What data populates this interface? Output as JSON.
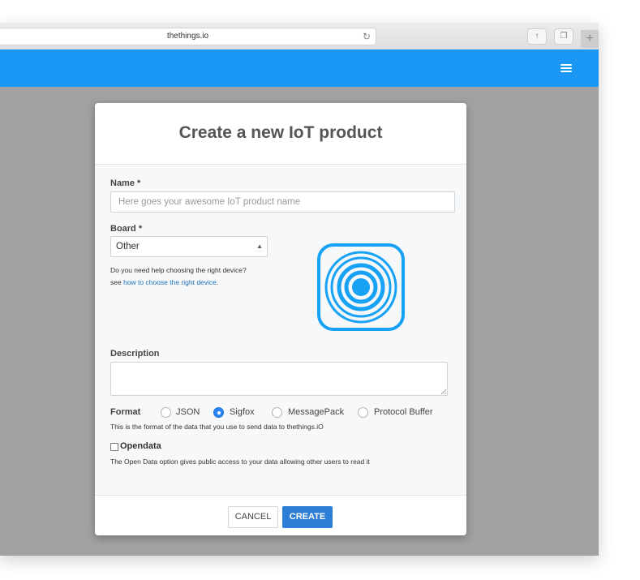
{
  "browser": {
    "url": "thethings.io",
    "reload_icon": "reload-icon",
    "share_icon": "share-icon",
    "tabs_icon": "tabs-icon",
    "new_tab_icon": "plus-icon"
  },
  "app_header": {
    "menu_icon": "hamburger-icon",
    "color": "#1a97f5"
  },
  "modal": {
    "title": "Create a new IoT product",
    "name": {
      "label": "Name *",
      "placeholder": "Here goes your awesome IoT product name",
      "value": ""
    },
    "board": {
      "label": "Board *",
      "selected": "Other",
      "help_line1": "Do you need help choosing the right device?",
      "help_prefix": "see ",
      "help_link": "how to choose the right device",
      "help_suffix": ".",
      "icon": "signal-icon",
      "icon_color": "#17a2f5"
    },
    "description": {
      "label": "Description",
      "value": ""
    },
    "format": {
      "label": "Format",
      "options": [
        "JSON",
        "Sigfox",
        "MessagePack",
        "Protocol Buffer"
      ],
      "selected": "Sigfox",
      "help": "This is the format of the data that you use to send data to thethings.iO"
    },
    "opendata": {
      "label": "Opendata",
      "checked": false,
      "help": "The Open Data option gives public access to your data allowing other users to read it"
    },
    "buttons": {
      "cancel": "CANCEL",
      "create": "CREATE"
    }
  },
  "colors": {
    "accent": "#1a97f5",
    "primary_button": "#2c7ed6",
    "overlay": "#a1a1a1"
  }
}
